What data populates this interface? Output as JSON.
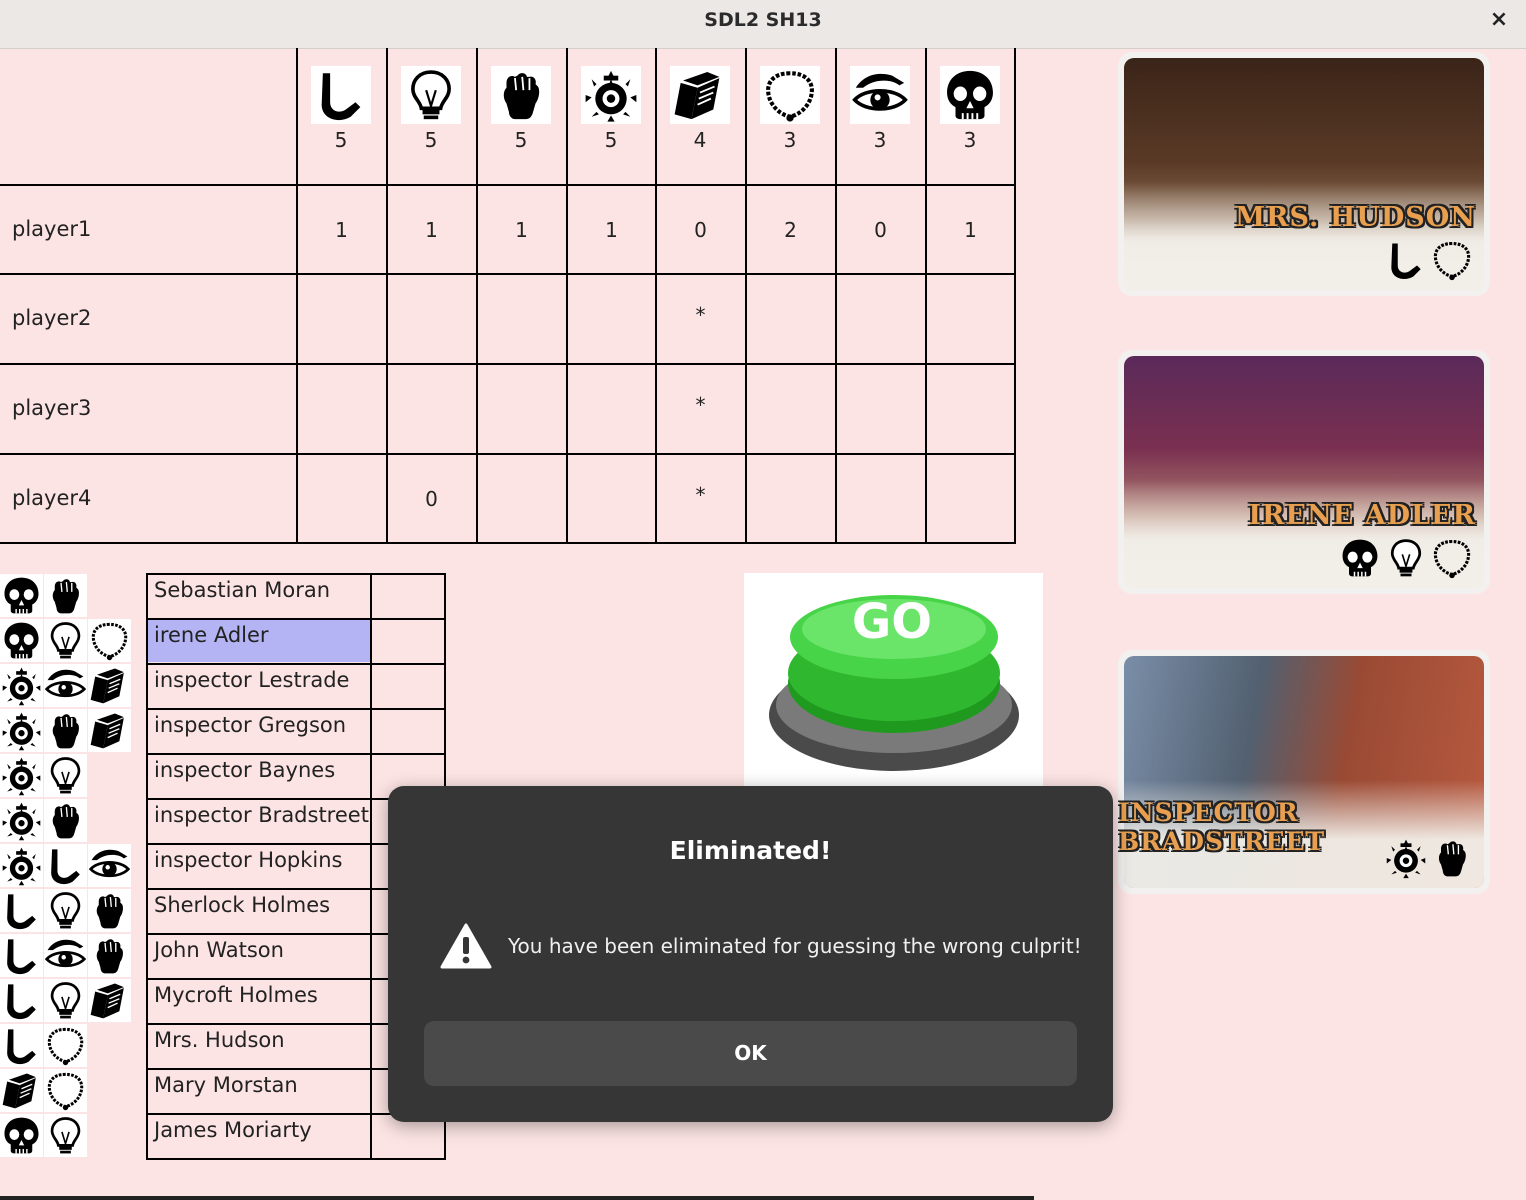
{
  "window": {
    "title": "SDL2 SH13",
    "close_glyph": "×"
  },
  "icons": [
    "pipe-icon",
    "lightbulb-icon",
    "fist-icon",
    "badge-icon",
    "book-icon",
    "necklace-icon",
    "eye-icon",
    "skull-icon"
  ],
  "header_counts": [
    "5",
    "5",
    "5",
    "5",
    "4",
    "3",
    "3",
    "3"
  ],
  "players": [
    {
      "name": "player1",
      "values": [
        "1",
        "1",
        "1",
        "1",
        "0",
        "2",
        "0",
        "1"
      ]
    },
    {
      "name": "player2",
      "values": [
        "",
        "",
        "",
        "",
        "*",
        "",
        "",
        ""
      ]
    },
    {
      "name": "player3",
      "values": [
        "",
        "",
        "",
        "",
        "*",
        "",
        "",
        ""
      ]
    },
    {
      "name": "player4",
      "values": [
        "",
        "0",
        "",
        "",
        "*",
        "",
        "",
        ""
      ]
    }
  ],
  "suspects": [
    {
      "name": "Sebastian Moran",
      "icons": [
        "skull-icon",
        "fist-icon"
      ]
    },
    {
      "name": "irene Adler",
      "icons": [
        "skull-icon",
        "lightbulb-icon",
        "necklace-icon"
      ],
      "selected": true
    },
    {
      "name": "inspector Lestrade",
      "icons": [
        "badge-icon",
        "eye-icon",
        "book-icon"
      ]
    },
    {
      "name": "inspector Gregson",
      "icons": [
        "badge-icon",
        "fist-icon",
        "book-icon"
      ]
    },
    {
      "name": "inspector Baynes",
      "icons": [
        "badge-icon",
        "lightbulb-icon"
      ]
    },
    {
      "name": "inspector Bradstreet",
      "icons": [
        "badge-icon",
        "fist-icon"
      ]
    },
    {
      "name": "inspector Hopkins",
      "icons": [
        "badge-icon",
        "pipe-icon",
        "eye-icon"
      ]
    },
    {
      "name": "Sherlock Holmes",
      "icons": [
        "pipe-icon",
        "lightbulb-icon",
        "fist-icon"
      ]
    },
    {
      "name": "John Watson",
      "icons": [
        "pipe-icon",
        "eye-icon",
        "fist-icon"
      ]
    },
    {
      "name": "Mycroft Holmes",
      "icons": [
        "pipe-icon",
        "lightbulb-icon",
        "book-icon"
      ]
    },
    {
      "name": "Mrs. Hudson",
      "icons": [
        "pipe-icon",
        "necklace-icon"
      ]
    },
    {
      "name": "Mary Morstan",
      "icons": [
        "book-icon",
        "necklace-icon"
      ]
    },
    {
      "name": "James Moriarty",
      "icons": [
        "skull-icon",
        "lightbulb-icon"
      ]
    }
  ],
  "go_button": {
    "label": "GO",
    "color": "#3cc83c"
  },
  "cards": [
    {
      "name": "MRS. HUDSON",
      "icons": [
        "pipe-icon",
        "necklace-icon"
      ]
    },
    {
      "name": "IRENE ADLER",
      "icons": [
        "skull-icon",
        "lightbulb-icon",
        "necklace-icon"
      ]
    },
    {
      "name": "INSPECTOR BRADSTREET",
      "icons": [
        "badge-icon",
        "fist-icon"
      ]
    }
  ],
  "dialog": {
    "title": "Eliminated!",
    "message": "You have been eliminated for guessing the wrong culprit!",
    "ok_label": "OK",
    "icon": "warning-icon"
  },
  "colors": {
    "background": "#fde4e4",
    "selected_row": "#b4b4f4",
    "dialog_bg": "#363636"
  }
}
